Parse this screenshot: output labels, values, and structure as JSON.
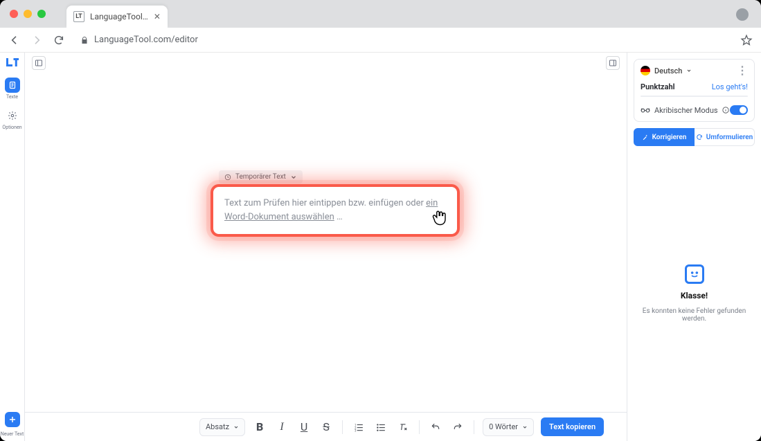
{
  "browser": {
    "tab_title": "LanguageTool…",
    "url": "LanguageTool.com/editor"
  },
  "app_logo": "LT",
  "left_rail": {
    "texts_label": "Texte",
    "options_label": "Optionen",
    "new_text_label": "Neuer Text"
  },
  "editor": {
    "temp_chip": "Temporärer Text",
    "placeholder_prefix": "Text zum Prüfen hier eintippen bzw. einfügen oder ",
    "placeholder_link": "ein Word-Dokument auswählen",
    "placeholder_suffix": " …"
  },
  "bottombar": {
    "style_select": "Absatz",
    "word_count": "0 Wörter",
    "copy_button": "Text kopieren"
  },
  "right_panel": {
    "language": "Deutsch",
    "score_label": "Punktzahl",
    "score_cta": "Los geht's!",
    "modus_label": "Akribischer Modus",
    "correct_btn": "Korrigieren",
    "reform_btn": "Umformulieren",
    "empty_title": "Klasse!",
    "empty_sub": "Es konnten keine Fehler gefunden werden."
  }
}
